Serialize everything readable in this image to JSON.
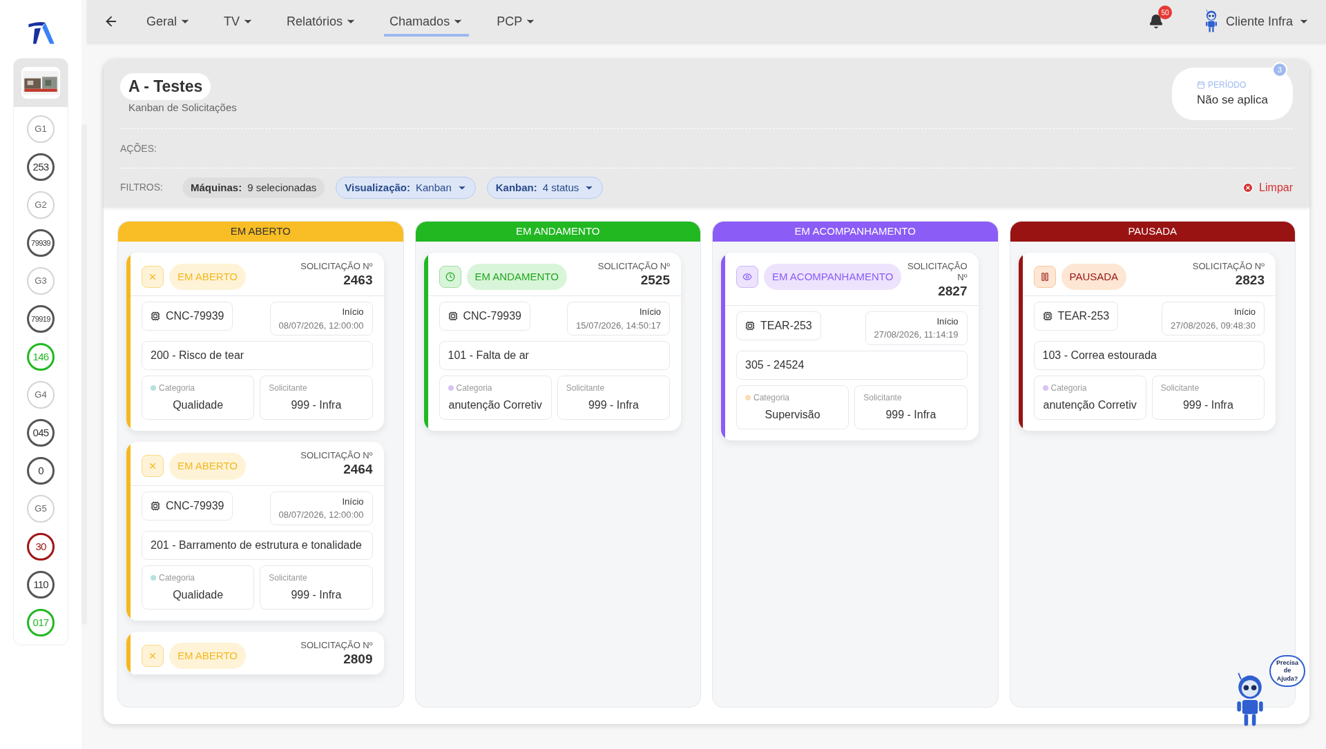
{
  "nav": {
    "items": [
      {
        "label": "Geral",
        "selected": false
      },
      {
        "label": "TV",
        "selected": false
      },
      {
        "label": "Relatórios",
        "selected": false
      },
      {
        "label": "Chamados",
        "selected": true
      },
      {
        "label": "PCP",
        "selected": false
      }
    ],
    "notifications": "50",
    "user": "Cliente Infra"
  },
  "sidebar": {
    "items": [
      {
        "label": "G1",
        "kind": "group"
      },
      {
        "label": "253",
        "kind": "machine",
        "color": "#555555"
      },
      {
        "label": "G2",
        "kind": "group"
      },
      {
        "label": "79939",
        "kind": "machine",
        "color": "#555555"
      },
      {
        "label": "G3",
        "kind": "group"
      },
      {
        "label": "79919",
        "kind": "machine",
        "color": "#555555"
      },
      {
        "label": "146",
        "kind": "machine",
        "color": "#22b822"
      },
      {
        "label": "G4",
        "kind": "group"
      },
      {
        "label": "045",
        "kind": "machine",
        "color": "#555555"
      },
      {
        "label": "0",
        "kind": "machine",
        "color": "#555555"
      },
      {
        "label": "G5",
        "kind": "group"
      },
      {
        "label": "30",
        "kind": "machine",
        "color": "#a01515"
      },
      {
        "label": "110",
        "kind": "machine",
        "color": "#555555"
      },
      {
        "label": "017",
        "kind": "machine",
        "color": "#22b822"
      }
    ]
  },
  "header": {
    "title": "A - Testes",
    "subtitle": "Kanban de Solicitações",
    "period": {
      "label": "PERÍODO",
      "value": "Não se aplica",
      "badge": "3"
    }
  },
  "actions": {
    "label": "AÇÕES:"
  },
  "filters": {
    "label": "FILTROS:",
    "items": [
      {
        "name": "Máquinas:",
        "value": "9 selecionadas",
        "kind": "static"
      },
      {
        "name": "Visualização:",
        "value": "Kanban",
        "kind": "dropdown"
      },
      {
        "name": "Kanban:",
        "value": "4 status",
        "kind": "dropdown"
      }
    ],
    "clear": "Limpar"
  },
  "columns": [
    {
      "title": "EM ABERTO",
      "kind": "open",
      "cards": [
        {
          "status": "EM ABERTO",
          "number_label": "SOLICITAÇÃO Nº",
          "number": "2463",
          "machine": "CNC-79939",
          "start_label": "Início",
          "start": "08/07/2026, 12:00:00",
          "defect": "200 - Risco de tear",
          "category_label": "Categoria",
          "category": "Qualidade",
          "color": "#b5e3dc",
          "requester_label": "Solicitante",
          "requester": "999 - Infra"
        },
        {
          "status": "EM ABERTO",
          "number_label": "SOLICITAÇÃO Nº",
          "number": "2464",
          "machine": "CNC-79939",
          "start_label": "Início",
          "start": "08/07/2026, 12:00:00",
          "defect": "201 - Barramento de estrutura e tonalidade",
          "category_label": "Categoria",
          "category": "Qualidade",
          "color": "#b5e3dc",
          "requester_label": "Solicitante",
          "requester": "999 - Infra"
        },
        {
          "status": "EM ABERTO",
          "number_label": "SOLICITAÇÃO Nº",
          "number": "2809"
        }
      ]
    },
    {
      "title": "EM ANDAMENTO",
      "kind": "progress",
      "cards": [
        {
          "status": "EM ANDAMENTO",
          "number_label": "SOLICITAÇÃO Nº",
          "number": "2525",
          "machine": "CNC-79939",
          "start_label": "Início",
          "start": "15/07/2026, 14:50:17",
          "defect": "101 - Falta de ar",
          "category_label": "Categoria",
          "category": "anutenção Corretiv",
          "color": "#d8c4f5",
          "requester_label": "Solicitante",
          "requester": "999 - Infra"
        }
      ]
    },
    {
      "title": "EM ACOMPANHAMENTO",
      "kind": "follow",
      "cards": [
        {
          "status": "EM ACOMPANHAMENTO",
          "number_label": "SOLICITAÇÃO Nº",
          "number": "2827",
          "machine": "TEAR-253",
          "start_label": "Início",
          "start": "27/08/2026, 11:14:19",
          "defect": "305 - 24524",
          "category_label": "Categoria",
          "category": "Supervisão",
          "color": "#fcdcb5",
          "requester_label": "Solicitante",
          "requester": "999 - Infra"
        }
      ]
    },
    {
      "title": "PAUSADA",
      "kind": "paused",
      "cards": [
        {
          "status": "PAUSADA",
          "number_label": "SOLICITAÇÃO Nº",
          "number": "2823",
          "machine": "TEAR-253",
          "start_label": "Início",
          "start": "27/08/2026, 09:48:30",
          "defect": "103 - Correa estourada",
          "category_label": "Categoria",
          "category": "anutenção Corretiv",
          "color": "#d8c4f5",
          "requester_label": "Solicitante",
          "requester": "999 - Infra"
        }
      ]
    }
  ],
  "help": {
    "bubble": "Precisa de Ajuda?"
  }
}
